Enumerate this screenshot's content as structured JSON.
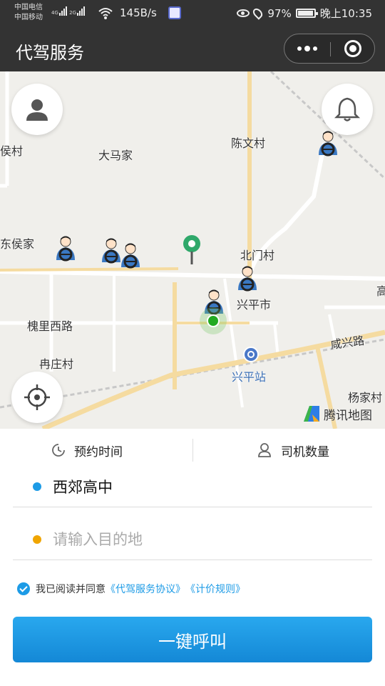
{
  "status_bar": {
    "carrier_1": "中国电信",
    "carrier_2": "中国移动",
    "net_1": "4G",
    "net_2": "2G",
    "speed": "145B/s",
    "battery": "97%",
    "time": "晚上10:35"
  },
  "header": {
    "title": "代驾服务"
  },
  "map": {
    "labels": {
      "hou_cun": "侯村",
      "da_ma_jia": "大马家",
      "chen_wen_cun": "陈文村",
      "dong_hou_jia": "东侯家",
      "bei_men_cun": "北门村",
      "xing_ping_shi": "兴平市",
      "gao": "高",
      "huai_li_xi_lu": "槐里西路",
      "xian_xing_lu": "咸兴路",
      "ran_zhuang_cun": "冉庄村",
      "xing_ping_zhan": "兴平站",
      "yang_jia_cun": "杨家村"
    },
    "provider": "腾讯地图",
    "drivers_count": 6
  },
  "tabs": {
    "reserve_time": "预约时间",
    "driver_count": "司机数量"
  },
  "form": {
    "start_value": "西郊高中",
    "destination_placeholder": "请输入目的地"
  },
  "agreement": {
    "prefix": "我已阅读并同意",
    "link_1": "《代驾服务协议》",
    "link_2": "《计价规则》",
    "checked": true
  },
  "call_button": "一键呼叫",
  "colors": {
    "accent": "#1d9be6",
    "start_dot": "#1d9be6",
    "dest_dot": "#f0a500",
    "header_bg": "#333333"
  }
}
